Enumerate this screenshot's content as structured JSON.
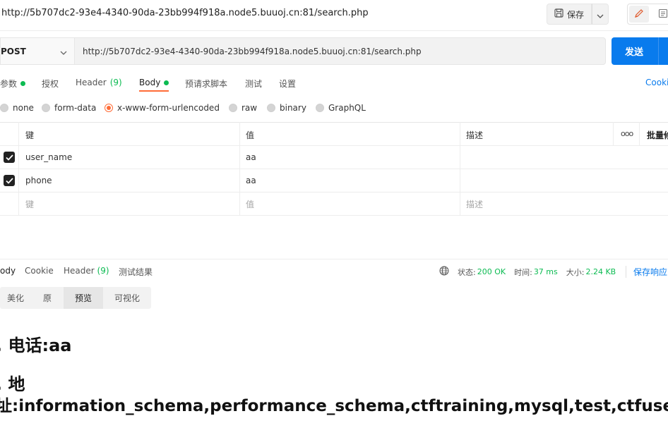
{
  "titlebar": {
    "title": "http://5b707dc2-93e4-4340-90da-23bb994f918a.node5.buuoj.cn:81/search.php",
    "save_label": "保存"
  },
  "request": {
    "method": "POST",
    "url": "http://5b707dc2-93e4-4340-90da-23bb994f918a.node5.buuoj.cn:81/search.php",
    "send_label": "发送"
  },
  "request_tabs": {
    "params": "参数",
    "auth": "授权",
    "header": "Header",
    "header_count": "(9)",
    "body": "Body",
    "prerequest": "预请求脚本",
    "tests": "测试",
    "settings": "设置",
    "cookies": "Cooki"
  },
  "body_types": {
    "none": "none",
    "form_data": "form-data",
    "urlencoded": "x-www-form-urlencoded",
    "raw": "raw",
    "binary": "binary",
    "graphql": "GraphQL",
    "selected": "x-www-form-urlencoded"
  },
  "params_table": {
    "headers": {
      "key": "键",
      "value": "值",
      "description": "描述",
      "bulk": "批量修"
    },
    "rows": [
      {
        "key": "user_name",
        "value": "aa",
        "checked": true
      },
      {
        "key": "phone",
        "value": "aa",
        "checked": true
      }
    ],
    "placeholders": {
      "key": "键",
      "value": "值",
      "description": "描述"
    }
  },
  "response": {
    "tabs": {
      "body": "ody",
      "cookie": "Cookie",
      "header": "Header",
      "header_count": "(9)",
      "tests": "测试结果"
    },
    "status_label": "状态:",
    "status_value": "200 OK",
    "time_label": "时间:",
    "time_value": "37 ms",
    "size_label": "大小:",
    "size_value": "2.24 KB",
    "save_label": "保存响应"
  },
  "view_modes": {
    "pretty": "美化",
    "raw": "原",
    "preview": "预览",
    "visualize": "可视化",
    "selected": "预览"
  },
  "preview": {
    "line1": ", 电话:aa",
    "line2": ", 地",
    "line3": "址:information_schema,performance_schema,ctftraining,mysql,test,ctfusers"
  },
  "colors": {
    "accent": "#ff6c37",
    "send": "#097bed",
    "success": "#0cbb52"
  }
}
